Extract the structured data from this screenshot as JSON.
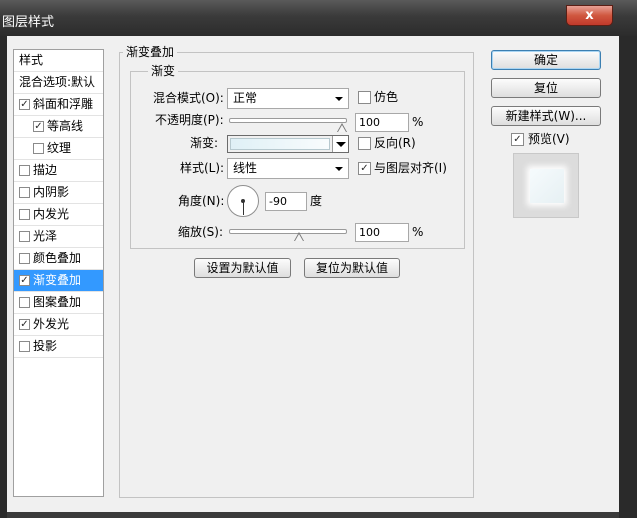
{
  "window": {
    "title": "图层样式",
    "close_label": "x"
  },
  "sidebar": {
    "header_styles": "样式",
    "header_blend": "混合选项:默认",
    "items": [
      {
        "label": "斜面和浮雕",
        "checked": true,
        "check_mark": "✓",
        "indent": false,
        "selected": false
      },
      {
        "label": "等高线",
        "checked": true,
        "check_mark": "✓",
        "indent": true,
        "selected": false
      },
      {
        "label": "纹理",
        "checked": false,
        "check_mark": "",
        "indent": true,
        "selected": false
      },
      {
        "label": "描边",
        "checked": false,
        "check_mark": "",
        "indent": false,
        "selected": false
      },
      {
        "label": "内阴影",
        "checked": false,
        "check_mark": "",
        "indent": false,
        "selected": false
      },
      {
        "label": "内发光",
        "checked": false,
        "check_mark": "",
        "indent": false,
        "selected": false
      },
      {
        "label": "光泽",
        "checked": false,
        "check_mark": "",
        "indent": false,
        "selected": false
      },
      {
        "label": "颜色叠加",
        "checked": false,
        "check_mark": "",
        "indent": false,
        "selected": false
      },
      {
        "label": "渐变叠加",
        "checked": true,
        "check_mark": "✓",
        "indent": false,
        "selected": true
      },
      {
        "label": "图案叠加",
        "checked": false,
        "check_mark": "",
        "indent": false,
        "selected": false
      },
      {
        "label": "外发光",
        "checked": true,
        "check_mark": "✓",
        "indent": false,
        "selected": false
      },
      {
        "label": "投影",
        "checked": false,
        "check_mark": "",
        "indent": false,
        "selected": false
      }
    ]
  },
  "panel": {
    "group_title": "渐变叠加",
    "subgroup_title": "渐变",
    "blend_mode_label": "混合模式(O):",
    "blend_mode_value": "正常",
    "dither_label": "仿色",
    "dither_checked": false,
    "opacity_label": "不透明度(P):",
    "opacity_value": "100",
    "opacity_unit": "%",
    "opacity_fraction": 1.0,
    "gradient_label": "渐变:",
    "gradient_colors": [
      "#dff0f6",
      "#f9fcfd"
    ],
    "reverse_label": "反向(R)",
    "reverse_checked": false,
    "style_label": "样式(L):",
    "style_value": "线性",
    "align_label": "与图层对齐(I)",
    "align_checked": true,
    "align_check_mark": "✓",
    "angle_label": "角度(N):",
    "angle_value": "-90",
    "angle_unit": "度",
    "scale_label": "缩放(S):",
    "scale_value": "100",
    "scale_unit": "%",
    "scale_fraction": 0.6,
    "set_default_label": "设置为默认值",
    "reset_default_label": "复位为默认值"
  },
  "actions": {
    "ok_label": "确定",
    "reset_label": "复位",
    "new_style_label": "新建样式(W)...",
    "preview_label": "预览(V)",
    "preview_checked": true,
    "preview_check_mark": "✓"
  },
  "colors": {
    "selection": "#3399ff",
    "dialog_bg": "#f0f0f0",
    "titlebar": "#3a3a3a",
    "close_button": "#c94a35"
  },
  "icons": {
    "close": "close-icon",
    "dropdown": "chevron-down-icon",
    "dial": "angle-dial-icon",
    "slider": "slider-thumb-icon"
  }
}
